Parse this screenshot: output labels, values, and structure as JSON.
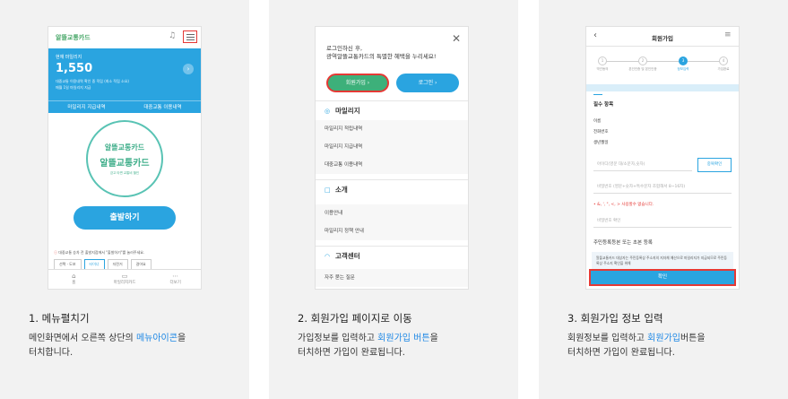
{
  "steps": [
    {
      "caption": "1. 메뉴펼치기",
      "desc_pre": "메인화면에서 오른쪽 상단의 ",
      "desc_hl": "메뉴아이콘",
      "desc_post": "을",
      "desc_line2": "터치합니다."
    },
    {
      "caption": "2. 회원가입 페이지로 이동",
      "desc_pre": "가입정보를 입력하고 ",
      "desc_hl": "회원가입 버튼",
      "desc_post": "을",
      "desc_line2": "터치하면 가입이 완료됩니다."
    },
    {
      "caption": "3. 회원가입 정보 입력",
      "desc_pre": "회원정보를 입력하고 ",
      "desc_hl": "회원가입",
      "desc_post": "버튼을",
      "desc_line2": "터치하면 가입이 완료됩니다."
    }
  ],
  "colors": {
    "accent_blue": "#2aa4e0",
    "green": "#3db07a",
    "highlight_red": "#e53935",
    "link_blue": "#1e88e5"
  },
  "screen1": {
    "logo": "알뜰교통카드",
    "bell_icon": "bell-icon",
    "menu_icon": "menu-icon",
    "mileage_label": "현재 마일리지",
    "mileage_value": "1,550",
    "note1": "대중교통 이용내역 확인 중 적립 (최소 적립 소요)",
    "note2": "매월 1일 마일리지 지급",
    "tab_mileage": "마일리지 지급내역",
    "tab_transit": "대중교통 이용내역",
    "circle_icons": "알뜰교통카드",
    "circle_name": "알뜰교통카드",
    "circle_sub": "걷고 타면 교통비 할인",
    "go_button": "출발하기",
    "notice": "대중교통 승차 전 출발지점에서 \"출발하기\"를 눌러주세요.",
    "modes": [
      "선택 · 도보",
      "타이너",
      "자전거",
      "걸어요"
    ],
    "nav": [
      {
        "label": "홈",
        "icon": "home-icon",
        "glyph": "⌂"
      },
      {
        "label": "마일리지카드",
        "icon": "card-icon",
        "glyph": "▭"
      },
      {
        "label": "더보기",
        "icon": "more-icon",
        "glyph": "⋯"
      }
    ]
  },
  "screen2": {
    "close_icon": "close-icon",
    "intro_line1": "로그인하신 후,",
    "intro_line2": "광역알뜰교통카드의 특별한 혜택을 누리세요!",
    "join_button": "회원가입",
    "login_button": "로그인",
    "sections": [
      {
        "title": "마일리지",
        "icon": "mileage-icon",
        "glyph": "◎",
        "items": [
          "마일리지 적립내역",
          "마일리지 지급내역",
          "대중교통 이용내역"
        ]
      },
      {
        "title": "소개",
        "icon": "info-icon",
        "glyph": "□",
        "items": [
          "이용안내",
          "마일리지 정책 안내"
        ]
      },
      {
        "title": "고객센터",
        "icon": "headset-icon",
        "glyph": "◠",
        "items": [
          "자주 묻는 질문"
        ]
      }
    ]
  },
  "screen3": {
    "back_icon": "back-icon",
    "title": "회원가입",
    "menu_icon": "menu-icon",
    "steps": [
      {
        "num": "1",
        "label": "약관동의"
      },
      {
        "num": "2",
        "label": "본인인증 및 본인인증"
      },
      {
        "num": "3",
        "label": "정보입력"
      },
      {
        "num": "4",
        "label": "가입완료"
      }
    ],
    "required": "필수 항목",
    "field_name": "이름",
    "field_phone": "전화번호",
    "field_birth": "생년월일",
    "id_placeholder": "아이디(영문 대/소문자,숫자)",
    "dup_button": "중복확인",
    "pw_placeholder": "비밀번호 (영문+숫자+특수문자 조합해서 8~16자)",
    "pw_warning": "• &, ', \", <, > 사용할수 없습니다.",
    "pw_confirm_placeholder": "비밀번호 확인",
    "rrn_label": "주민등록등본 또는 초본 등록",
    "notice": "알뜰교통카드 대상자는 주민등록상 주소지의 지자체 예산으로 마일리지가 지급되므로 주민등록상 주소지 확인을 위해",
    "confirm_button": "확인"
  }
}
